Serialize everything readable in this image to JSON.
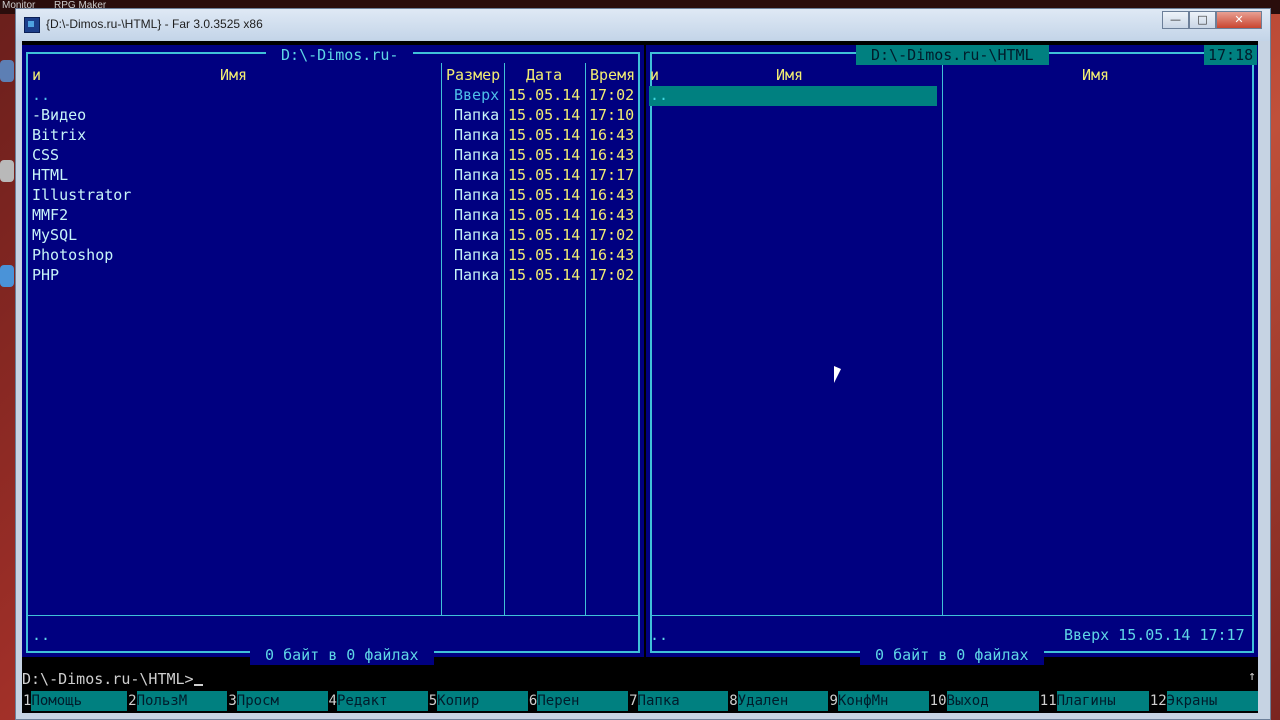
{
  "desktop": {
    "top_items": [
      "Monitor",
      "RPG Maker"
    ]
  },
  "window": {
    "title": "{D:\\-Dimos.ru-\\HTML} - Far 3.0.3525 x86",
    "min": "—",
    "max": "□",
    "close": "✕"
  },
  "left_panel": {
    "path": " D:\\-Dimos.ru- ",
    "col_n": "и",
    "col_name": "Имя",
    "col_size": "Размер",
    "col_date": "Дата",
    "col_time": "Время",
    "rows": [
      {
        "name": "..",
        "size": "Вверх",
        "date": "15.05.14",
        "time": "17:02"
      },
      {
        "name": "-Видео",
        "size": "Папка",
        "date": "15.05.14",
        "time": "17:10"
      },
      {
        "name": "Bitrix",
        "size": "Папка",
        "date": "15.05.14",
        "time": "16:43"
      },
      {
        "name": "CSS",
        "size": "Папка",
        "date": "15.05.14",
        "time": "16:43"
      },
      {
        "name": "HTML",
        "size": "Папка",
        "date": "15.05.14",
        "time": "17:17"
      },
      {
        "name": "Illustrator",
        "size": "Папка",
        "date": "15.05.14",
        "time": "16:43"
      },
      {
        "name": "MMF2",
        "size": "Папка",
        "date": "15.05.14",
        "time": "16:43"
      },
      {
        "name": "MySQL",
        "size": "Папка",
        "date": "15.05.14",
        "time": "17:02"
      },
      {
        "name": "Photoshop",
        "size": "Папка",
        "date": "15.05.14",
        "time": "16:43"
      },
      {
        "name": "PHP",
        "size": "Папка",
        "date": "15.05.14",
        "time": "17:02"
      }
    ],
    "status_name": "..",
    "totals": " 0 байт в 0 файлах "
  },
  "right_panel": {
    "path": " D:\\-Dimos.ru-\\HTML ",
    "clock": "17:18",
    "col_n": "и",
    "col_name1": "Имя",
    "col_name2": "Имя",
    "row_updir": "..",
    "status_name": "..",
    "status_info": "Вверх 15.05.14 17:17",
    "totals": " 0 байт в 0 файлах "
  },
  "command_line": {
    "prompt": "D:\\-Dimos.ru-\\HTML>",
    "scroll_indicator": "↑"
  },
  "keybar": [
    {
      "num": "1",
      "label": "Помощь"
    },
    {
      "num": "2",
      "label": "ПользМ"
    },
    {
      "num": "3",
      "label": "Просм"
    },
    {
      "num": "4",
      "label": "Редакт"
    },
    {
      "num": "5",
      "label": "Копир"
    },
    {
      "num": "6",
      "label": "Перен"
    },
    {
      "num": "7",
      "label": "Папка"
    },
    {
      "num": "8",
      "label": "Удален"
    },
    {
      "num": "9",
      "label": "КонфМн"
    },
    {
      "num": "10",
      "label": "Выход"
    },
    {
      "num": "11",
      "label": "Плагины"
    },
    {
      "num": "12",
      "label": "Экраны"
    }
  ],
  "colors": {
    "panel_bg": "#000080",
    "frame": "#40c0d8",
    "header": "#f2ee72",
    "selection": "#008080"
  }
}
